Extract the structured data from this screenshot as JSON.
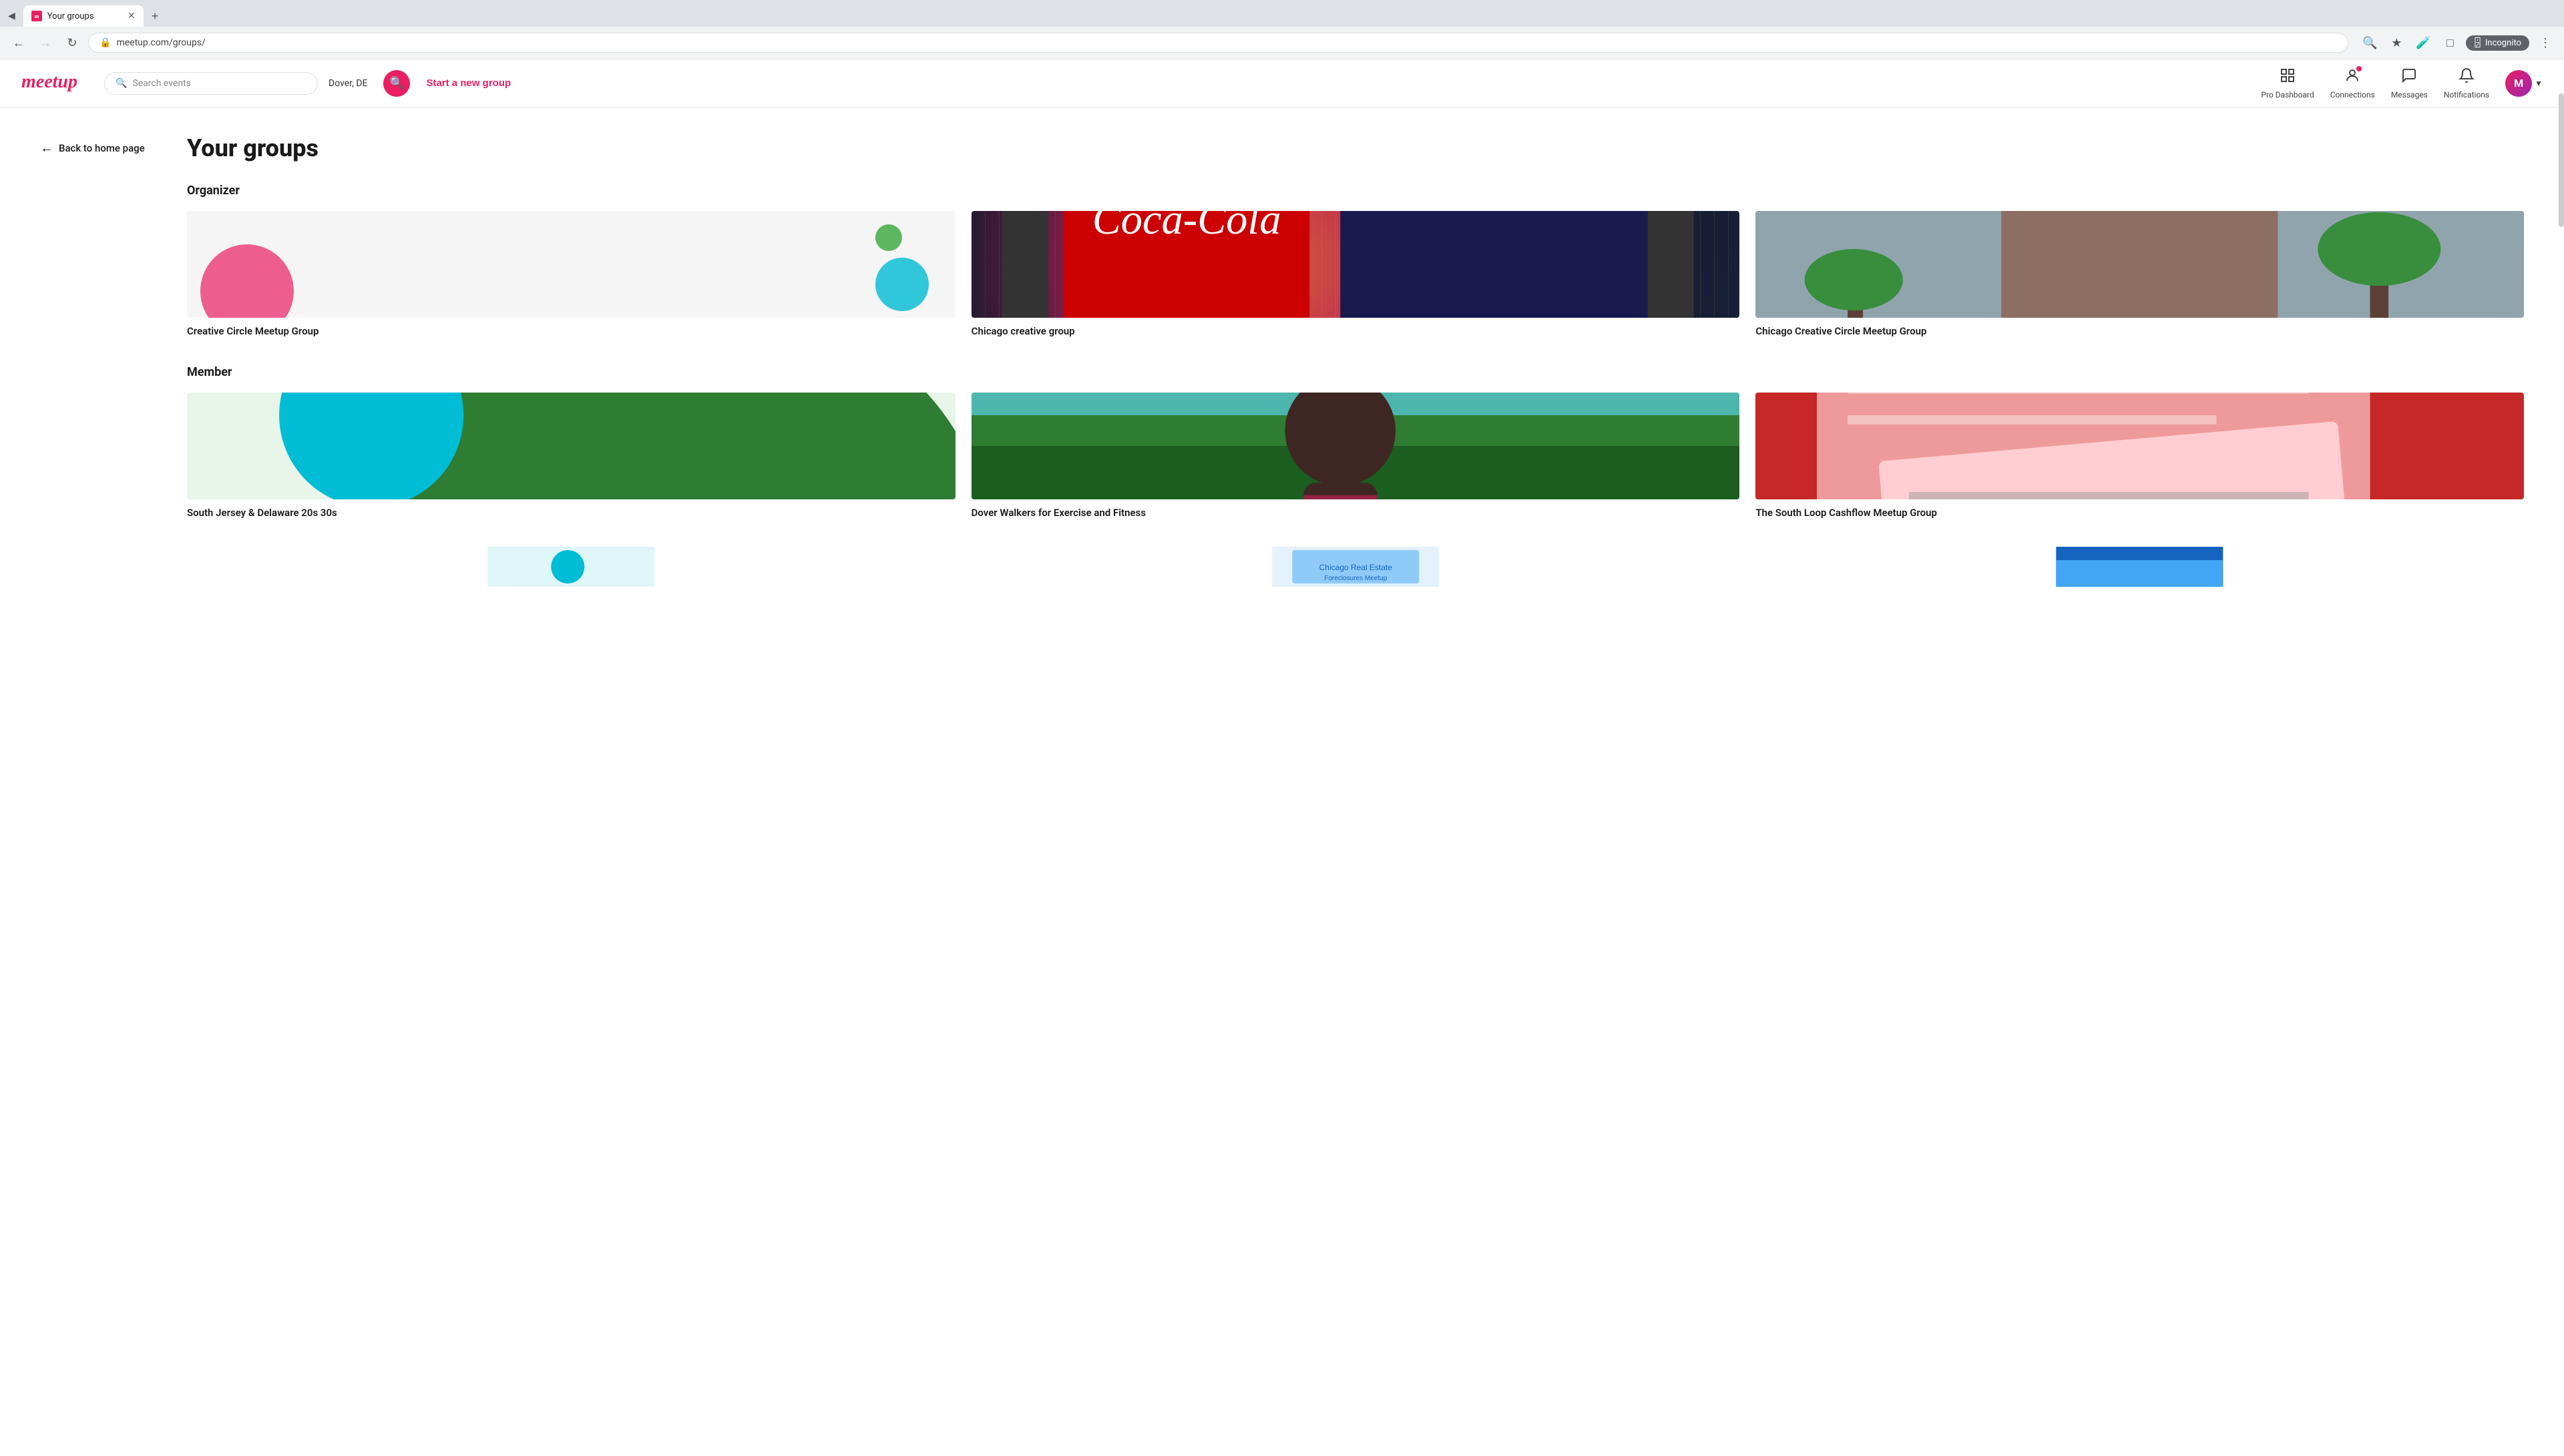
{
  "browser": {
    "tab_title": "Your groups",
    "tab_favicon": "M",
    "url": "meetup.com/groups/",
    "new_tab_label": "+",
    "nav": {
      "back_disabled": false,
      "forward_disabled": true,
      "reload_label": "↻"
    },
    "incognito_label": "Incognito"
  },
  "header": {
    "logo_text": "meetup",
    "search_placeholder": "Search events",
    "location": "Dover, DE",
    "search_btn_icon": "🔍",
    "start_group_label": "Start a new group",
    "nav_items": [
      {
        "key": "pro_dashboard",
        "label": "Pro Dashboard",
        "icon": "⊞"
      },
      {
        "key": "connections",
        "label": "Connections",
        "icon": "👤",
        "has_dot": true
      },
      {
        "key": "messages",
        "label": "Messages",
        "icon": "💬"
      },
      {
        "key": "notifications",
        "label": "Notifications",
        "icon": "🔔"
      }
    ],
    "user_avatar_letter": "M"
  },
  "sidebar": {
    "back_link_label": "Back to home page"
  },
  "main": {
    "page_title": "Your groups",
    "organizer_section": {
      "label": "Organizer",
      "groups": [
        {
          "key": "creative-circle",
          "name": "Creative Circle Meetup Group",
          "type": "illustration"
        },
        {
          "key": "chicago-creative",
          "name": "Chicago creative group",
          "type": "photo-neon"
        },
        {
          "key": "chicago-creative-circle",
          "name": "Chicago Creative Circle Meetup Group",
          "type": "photo-arch"
        }
      ]
    },
    "member_section": {
      "label": "Member",
      "groups": [
        {
          "key": "south-jersey",
          "name": "South Jersey & Delaware 20s 30s",
          "type": "illustration-blob"
        },
        {
          "key": "dover-walkers",
          "name": "Dover Walkers for Exercise and Fitness",
          "type": "photo-person"
        },
        {
          "key": "south-loop",
          "name": "The South Loop Cashflow Meetup Group",
          "type": "photo-papers"
        }
      ]
    }
  }
}
